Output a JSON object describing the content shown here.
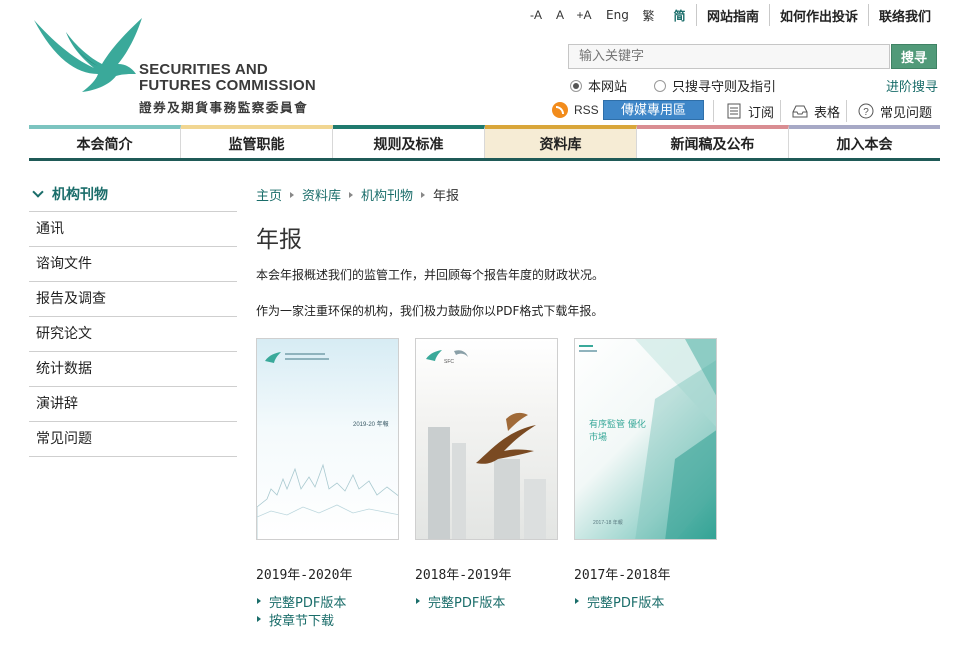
{
  "header": {
    "org_name_en_line1": "SECURITIES AND",
    "org_name_en_line2": "FUTURES COMMISSION",
    "org_name_zh": "證券及期貨事務監察委員會",
    "font_sizes": [
      "-A",
      "A",
      "+A"
    ],
    "languages": [
      {
        "label": "Eng",
        "active": false
      },
      {
        "label": "繁",
        "active": false
      },
      {
        "label": "简",
        "active": true
      }
    ],
    "util_links": [
      "网站指南",
      "如何作出投诉",
      "联络我们"
    ]
  },
  "search": {
    "placeholder": "输入关键字",
    "button_label": "搜寻",
    "scope_options": [
      {
        "label": "本网站",
        "selected": true
      },
      {
        "label": "只搜寻守则及指引",
        "selected": false
      }
    ],
    "advanced_label": "进阶搜寻"
  },
  "tools": {
    "rss_label": "RSS",
    "media_label": "傳媒專用區",
    "subscribe_label": "订阅",
    "forms_label": "表格",
    "faq_label": "常见问题"
  },
  "nav": {
    "items": [
      {
        "label": "本会简介",
        "accent": "#7cc4c0",
        "active": false
      },
      {
        "label": "监管职能",
        "accent": "#f1d692",
        "active": false
      },
      {
        "label": "规则及标准",
        "accent": "#1f7a6e",
        "active": false
      },
      {
        "label": "资料库",
        "accent": "#d9a63a",
        "active": true
      },
      {
        "label": "新闻稿及公布",
        "accent": "#d98d92",
        "active": false
      },
      {
        "label": "加入本会",
        "accent": "#a7a9c6",
        "active": false
      }
    ]
  },
  "sidebar": {
    "heading": "机构刊物",
    "items": [
      {
        "label": "通讯"
      },
      {
        "label": "谘询文件"
      },
      {
        "label": "报告及调查"
      },
      {
        "label": "研究论文"
      },
      {
        "label": "统计数据"
      },
      {
        "label": "演讲辞"
      },
      {
        "label": "常见问题"
      }
    ]
  },
  "breadcrumb": [
    "主页",
    "资料库",
    "机构刊物",
    "年报"
  ],
  "page": {
    "title": "年报",
    "intro_1": "本会年报概述我们的监管工作，并回顾每个报告年度的财政状况。",
    "intro_2": "作为一家注重环保的机构，我们极力鼓励你以PDF格式下载年报。"
  },
  "reports": [
    {
      "year": "2019年-2020年",
      "cover_text": "2019-20 年報",
      "links": [
        {
          "label": "完整PDF版本"
        },
        {
          "label": "按章节下载"
        }
      ]
    },
    {
      "year": "2018年-2019年",
      "cover_text": "SFC",
      "links": [
        {
          "label": "完整PDF版本"
        }
      ]
    },
    {
      "year": "2017年-2018年",
      "cover_text": "有序監管 優化市場",
      "cover_footer": "2017-18 年報",
      "links": [
        {
          "label": "完整PDF版本"
        }
      ]
    }
  ],
  "colors": {
    "brand_teal": "#1a6d6a",
    "search_button": "#519a79",
    "media_button": "#3e86c8",
    "nav_active_bg": "#f6ecd5"
  }
}
